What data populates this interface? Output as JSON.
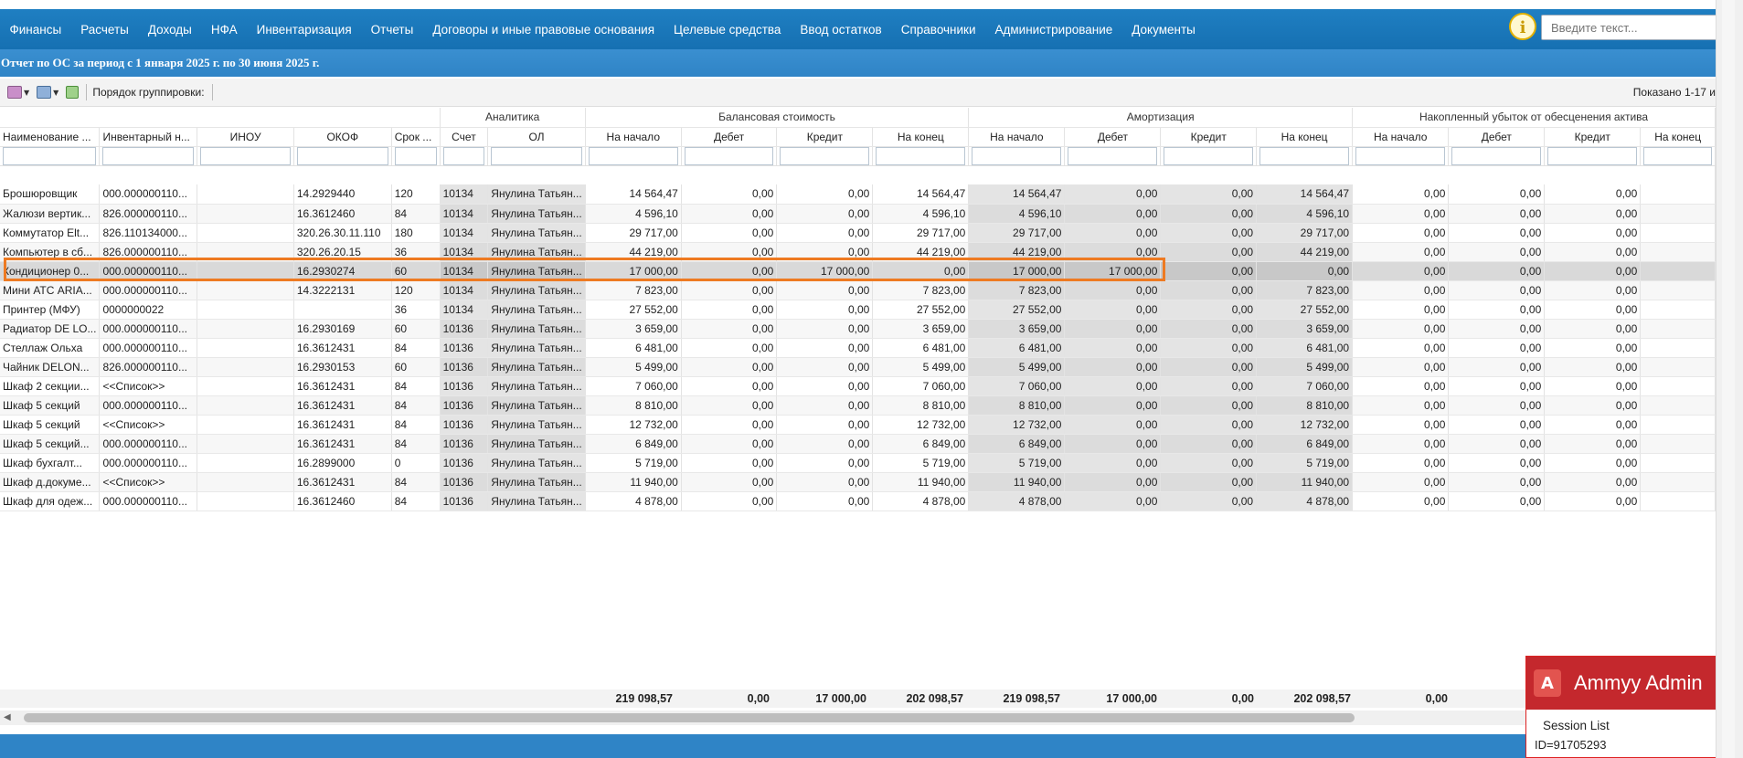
{
  "menu": {
    "items": [
      "Финансы",
      "Расчеты",
      "Доходы",
      "НФА",
      "Инвентаризация",
      "Отчеты",
      "Договоры и иные правовые основания",
      "Целевые средства",
      "Ввод остатков",
      "Справочники",
      "Администрирование",
      "Документы"
    ],
    "search_placeholder": "Введите текст..."
  },
  "title": "Отчет по ОС за период с 1 января 2025 г. по 30 июня 2025 г.",
  "toolbar": {
    "group_label": "Порядок группировки:",
    "shown": "Показано 1-17 и"
  },
  "groups": {
    "analytics": "Аналитика",
    "balance": "Балансовая стоимость",
    "amort": "Амортизация",
    "loss": "Накопленный убыток от обесценения актива"
  },
  "columns": [
    "Наименование ...",
    "Инвентарный н...",
    "ИНОУ",
    "ОКОФ",
    "Срок ...",
    "Счет",
    "ОЛ",
    "На начало",
    "Дебет",
    "Кредит",
    "На конец",
    "На начало",
    "Дебет",
    "Кредит",
    "На конец",
    "На начало",
    "Дебет",
    "Кредит",
    "На конец"
  ],
  "rows": [
    [
      "Брошюровщик",
      "000.000000110...",
      "",
      "14.2929440",
      "120",
      "10134",
      "Янулина Татьян...",
      "14 564,47",
      "0,00",
      "0,00",
      "14 564,47",
      "14 564,47",
      "0,00",
      "0,00",
      "14 564,47",
      "0,00",
      "0,00",
      "0,00",
      ""
    ],
    [
      "Жалюзи вертик...",
      "826.000000110...",
      "",
      "16.3612460",
      "84",
      "10134",
      "Янулина Татьян...",
      "4 596,10",
      "0,00",
      "0,00",
      "4 596,10",
      "4 596,10",
      "0,00",
      "0,00",
      "4 596,10",
      "0,00",
      "0,00",
      "0,00",
      ""
    ],
    [
      "Коммутатор Elt...",
      "826.110134000...",
      "",
      "320.26.30.11.110",
      "180",
      "10134",
      "Янулина Татьян...",
      "29 717,00",
      "0,00",
      "0,00",
      "29 717,00",
      "29 717,00",
      "0,00",
      "0,00",
      "29 717,00",
      "0,00",
      "0,00",
      "0,00",
      ""
    ],
    [
      "Компьютер в сб...",
      "826.000000110...",
      "",
      "320.26.20.15",
      "36",
      "10134",
      "Янулина Татьян...",
      "44 219,00",
      "0,00",
      "0,00",
      "44 219,00",
      "44 219,00",
      "0,00",
      "0,00",
      "44 219,00",
      "0,00",
      "0,00",
      "0,00",
      ""
    ],
    [
      "Кондиционер 0...",
      "000.000000110...",
      "",
      "16.2930274",
      "60",
      "10134",
      "Янулина Татьян...",
      "17 000,00",
      "0,00",
      "17 000,00",
      "0,00",
      "17 000,00",
      "17 000,00",
      "0,00",
      "0,00",
      "0,00",
      "0,00",
      "0,00",
      ""
    ],
    [
      "Мини АТС ARIA...",
      "000.000000110...",
      "",
      "14.3222131",
      "120",
      "10134",
      "Янулина Татьян...",
      "7 823,00",
      "0,00",
      "0,00",
      "7 823,00",
      "7 823,00",
      "0,00",
      "0,00",
      "7 823,00",
      "0,00",
      "0,00",
      "0,00",
      ""
    ],
    [
      "Принтер (МФУ)",
      "0000000022",
      "",
      "",
      "36",
      "10134",
      "Янулина Татьян...",
      "27 552,00",
      "0,00",
      "0,00",
      "27 552,00",
      "27 552,00",
      "0,00",
      "0,00",
      "27 552,00",
      "0,00",
      "0,00",
      "0,00",
      ""
    ],
    [
      "Радиатор DE LO...",
      "000.000000110...",
      "",
      "16.2930169",
      "60",
      "10136",
      "Янулина Татьян...",
      "3 659,00",
      "0,00",
      "0,00",
      "3 659,00",
      "3 659,00",
      "0,00",
      "0,00",
      "3 659,00",
      "0,00",
      "0,00",
      "0,00",
      ""
    ],
    [
      "Стеллаж Ольха",
      "000.000000110...",
      "",
      "16.3612431",
      "84",
      "10136",
      "Янулина Татьян...",
      "6 481,00",
      "0,00",
      "0,00",
      "6 481,00",
      "6 481,00",
      "0,00",
      "0,00",
      "6 481,00",
      "0,00",
      "0,00",
      "0,00",
      ""
    ],
    [
      "Чайник DELON...",
      "826.000000110...",
      "",
      "16.2930153",
      "60",
      "10136",
      "Янулина Татьян...",
      "5 499,00",
      "0,00",
      "0,00",
      "5 499,00",
      "5 499,00",
      "0,00",
      "0,00",
      "5 499,00",
      "0,00",
      "0,00",
      "0,00",
      ""
    ],
    [
      "Шкаф 2 секции...",
      "<<Список>>",
      "",
      "16.3612431",
      "84",
      "10136",
      "Янулина Татьян...",
      "7 060,00",
      "0,00",
      "0,00",
      "7 060,00",
      "7 060,00",
      "0,00",
      "0,00",
      "7 060,00",
      "0,00",
      "0,00",
      "0,00",
      ""
    ],
    [
      "Шкаф 5 секций",
      "000.000000110...",
      "",
      "16.3612431",
      "84",
      "10136",
      "Янулина Татьян...",
      "8 810,00",
      "0,00",
      "0,00",
      "8 810,00",
      "8 810,00",
      "0,00",
      "0,00",
      "8 810,00",
      "0,00",
      "0,00",
      "0,00",
      ""
    ],
    [
      "Шкаф 5 секций",
      "<<Список>>",
      "",
      "16.3612431",
      "84",
      "10136",
      "Янулина Татьян...",
      "12 732,00",
      "0,00",
      "0,00",
      "12 732,00",
      "12 732,00",
      "0,00",
      "0,00",
      "12 732,00",
      "0,00",
      "0,00",
      "0,00",
      ""
    ],
    [
      "Шкаф 5 секций...",
      "000.000000110...",
      "",
      "16.3612431",
      "84",
      "10136",
      "Янулина Татьян...",
      "6 849,00",
      "0,00",
      "0,00",
      "6 849,00",
      "6 849,00",
      "0,00",
      "0,00",
      "6 849,00",
      "0,00",
      "0,00",
      "0,00",
      ""
    ],
    [
      "Шкаф бухгалт...",
      "000.000000110...",
      "",
      "16.2899000",
      "0",
      "10136",
      "Янулина Татьян...",
      "5 719,00",
      "0,00",
      "0,00",
      "5 719,00",
      "5 719,00",
      "0,00",
      "0,00",
      "5 719,00",
      "0,00",
      "0,00",
      "0,00",
      ""
    ],
    [
      "Шкаф д.докуме...",
      "<<Список>>",
      "",
      "16.3612431",
      "84",
      "10136",
      "Янулина Татьян...",
      "11 940,00",
      "0,00",
      "0,00",
      "11 940,00",
      "11 940,00",
      "0,00",
      "0,00",
      "11 940,00",
      "0,00",
      "0,00",
      "0,00",
      ""
    ],
    [
      "Шкаф для одеж...",
      "000.000000110...",
      "",
      "16.3612460",
      "84",
      "10136",
      "Янулина Татьян...",
      "4 878,00",
      "0,00",
      "0,00",
      "4 878,00",
      "4 878,00",
      "0,00",
      "0,00",
      "4 878,00",
      "0,00",
      "0,00",
      "0,00",
      ""
    ]
  ],
  "selected_row": 4,
  "totals": [
    "219 098,57",
    "0,00",
    "17 000,00",
    "202 098,57",
    "219 098,57",
    "17 000,00",
    "0,00",
    "202 098,57",
    "0,00"
  ],
  "ammyy": {
    "title": "Ammyy Admin",
    "session": "Session List",
    "id": "ID=91705293"
  },
  "colors": {
    "menubar": "#1f7fc2",
    "highlight": "#ee7a22",
    "accent": "#2f84c6"
  }
}
